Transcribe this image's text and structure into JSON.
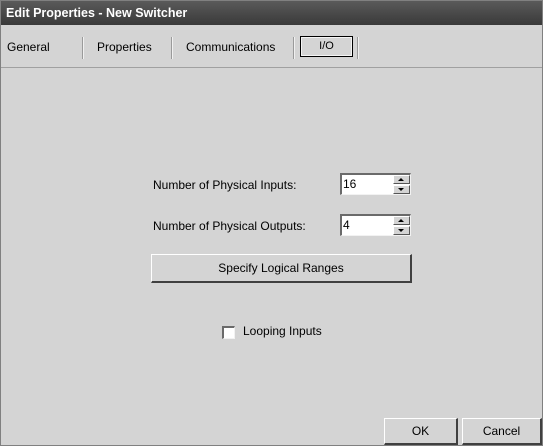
{
  "window": {
    "title": "Edit Properties - New Switcher"
  },
  "tabs": [
    {
      "label": "General",
      "active": false
    },
    {
      "label": "Properties",
      "active": false
    },
    {
      "label": "Communications",
      "active": false
    },
    {
      "label": "I/O",
      "active": true
    }
  ],
  "io": {
    "inputs_label": "Number of Physical Inputs:",
    "inputs_value": "16",
    "outputs_label": "Number of Physical Outputs:",
    "outputs_value": "4",
    "ranges_button": "Specify Logical Ranges",
    "looping_label": "Looping Inputs",
    "looping_checked": false
  },
  "footer": {
    "ok_label": "OK",
    "cancel_label": "Cancel"
  }
}
